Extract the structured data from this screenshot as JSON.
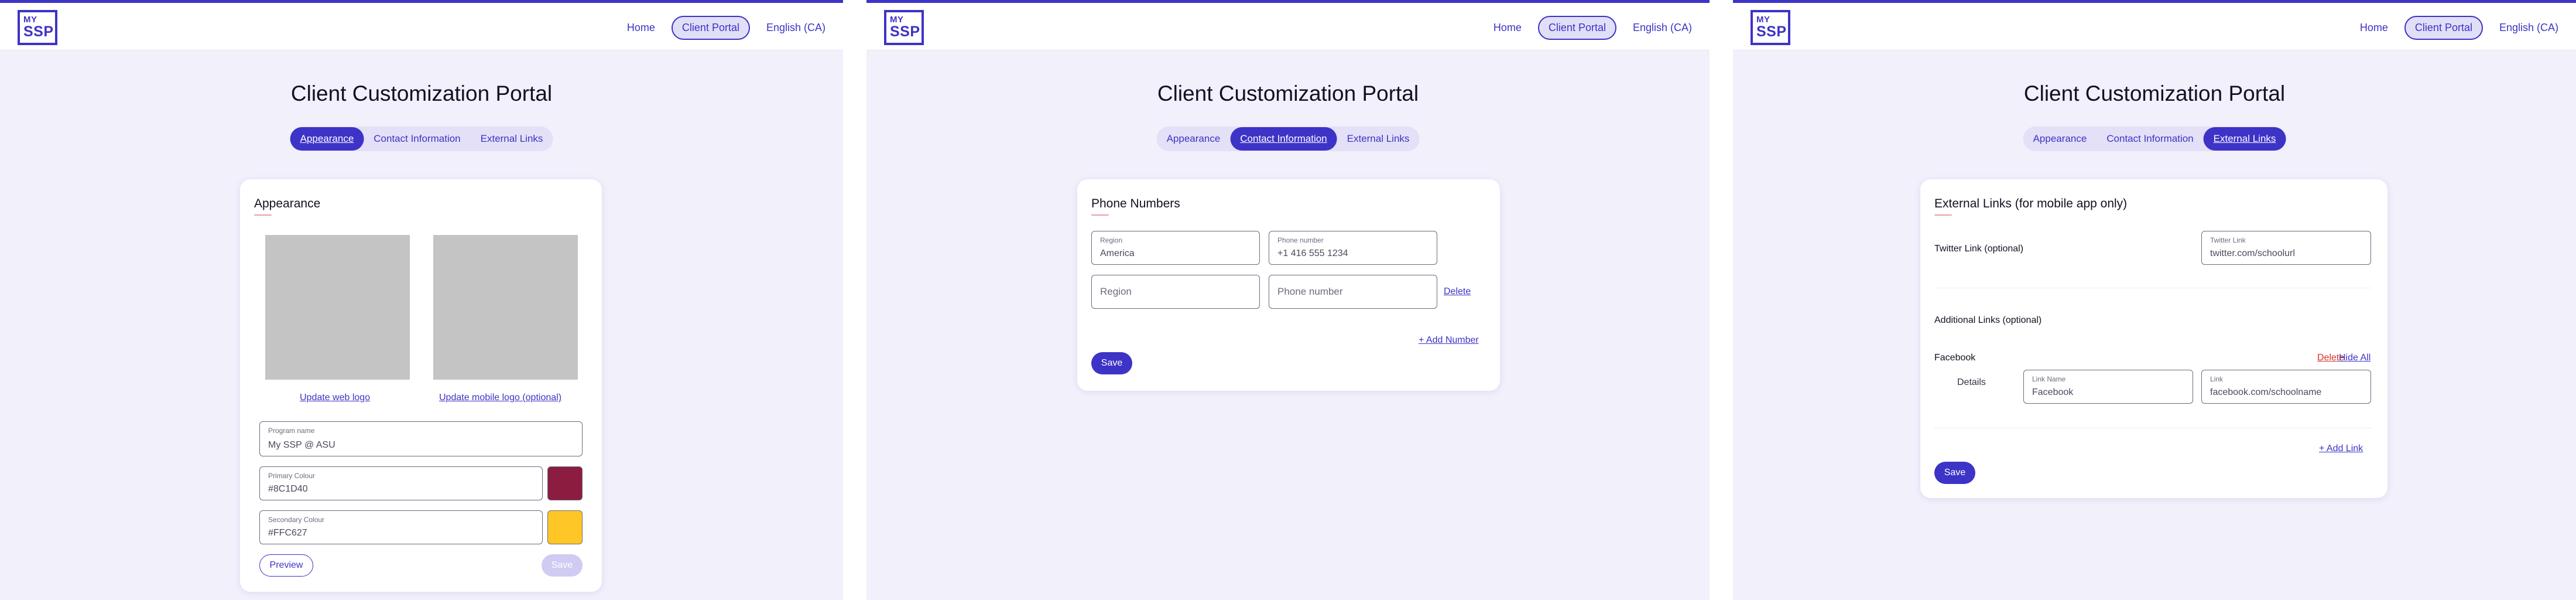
{
  "header": {
    "logo_line1": "MY",
    "logo_line2": "SSP",
    "nav_home": "Home",
    "nav_client_portal": "Client Portal",
    "nav_language": "English (CA)"
  },
  "page_title": "Client Customization Portal",
  "tabs": {
    "appearance": "Appearance",
    "contact": "Contact Information",
    "external": "External Links"
  },
  "appearance": {
    "title": "Appearance",
    "update_web_logo": "Update web logo",
    "update_mobile_logo": "Update mobile logo (optional)",
    "program_name_label": "Program name",
    "program_name_value": "My SSP @ ASU",
    "primary_label": "Primary Colour",
    "primary_value": "#8C1D40",
    "secondary_label": "Secondary Colour",
    "secondary_value": "#FFC627",
    "preview": "Preview",
    "save": "Save",
    "colors": {
      "primary": "#8C1D40",
      "secondary": "#FFC627"
    }
  },
  "contact": {
    "title": "Phone Numbers",
    "region_label": "Region",
    "region_value": "America",
    "phone_label": "Phone number",
    "phone_value": "+1 416 555 1234",
    "region_placeholder": "Region",
    "phone_placeholder": "Phone number",
    "delete": "Delete",
    "add_number": "+ Add Number",
    "save": "Save"
  },
  "external": {
    "title": "External Links (for mobile app only)",
    "twitter_heading": "Twitter Link (optional)",
    "twitter_label": "Twitter Link",
    "twitter_value": "twitter.com/schoolurl",
    "additional_heading": "Additional Links (optional)",
    "facebook_heading": "Facebook",
    "delete": "Delete",
    "hide_all": "Hide All",
    "details": "Details",
    "link_name_label": "Link Name",
    "link_name_value": "Facebook",
    "link_label": "Link",
    "link_value": "facebook.com/schoolname",
    "add_link": "+ Add Link",
    "save": "Save"
  }
}
